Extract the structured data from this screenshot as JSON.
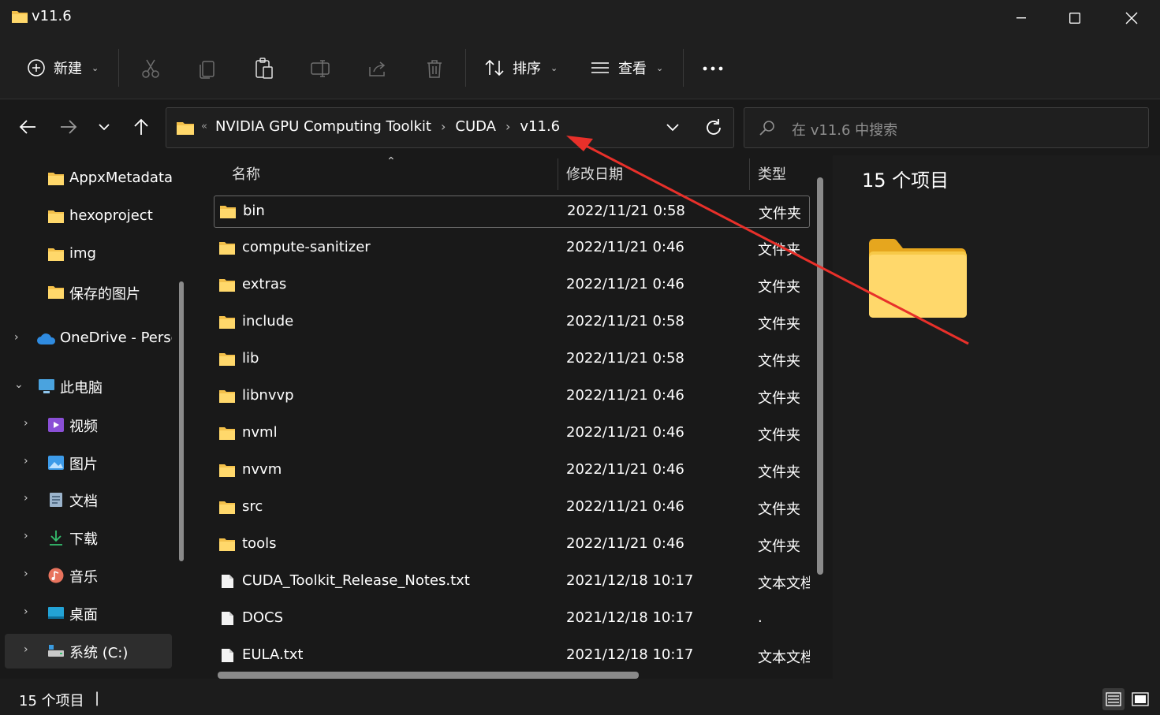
{
  "window": {
    "title": "v11.6"
  },
  "toolbar": {
    "new_label": "新建",
    "sort_label": "排序",
    "view_label": "查看",
    "more_label": "···"
  },
  "address": {
    "lead": "«",
    "crumbs": [
      "NVIDIA GPU Computing Toolkit",
      "CUDA",
      "v11.6"
    ]
  },
  "search": {
    "placeholder": "在 v11.6 中搜索"
  },
  "sidebar": {
    "items": [
      {
        "label": "AppxMetadata",
        "icon": "folder-icon"
      },
      {
        "label": "hexoproject",
        "icon": "folder-icon"
      },
      {
        "label": "img",
        "icon": "folder-icon"
      },
      {
        "label": "保存的图片",
        "icon": "folder-icon"
      },
      {
        "label": "OneDrive - Persc",
        "icon": "onedrive-icon"
      },
      {
        "label": "此电脑",
        "icon": "computer-icon"
      },
      {
        "label": "视频",
        "icon": "video-icon"
      },
      {
        "label": "图片",
        "icon": "pictures-icon"
      },
      {
        "label": "文档",
        "icon": "documents-icon"
      },
      {
        "label": "下载",
        "icon": "download-icon"
      },
      {
        "label": "音乐",
        "icon": "music-icon"
      },
      {
        "label": "桌面",
        "icon": "desktop-icon"
      },
      {
        "label": "系统 (C:)",
        "icon": "drive-icon"
      }
    ]
  },
  "columns": {
    "name": "名称",
    "date": "修改日期",
    "type": "类型"
  },
  "files": [
    {
      "name": "bin",
      "date": "2022/11/21 0:58",
      "type": "文件夹",
      "kind": "folder"
    },
    {
      "name": "compute-sanitizer",
      "date": "2022/11/21 0:46",
      "type": "文件夹",
      "kind": "folder"
    },
    {
      "name": "extras",
      "date": "2022/11/21 0:46",
      "type": "文件夹",
      "kind": "folder"
    },
    {
      "name": "include",
      "date": "2022/11/21 0:58",
      "type": "文件夹",
      "kind": "folder"
    },
    {
      "name": "lib",
      "date": "2022/11/21 0:58",
      "type": "文件夹",
      "kind": "folder"
    },
    {
      "name": "libnvvp",
      "date": "2022/11/21 0:46",
      "type": "文件夹",
      "kind": "folder"
    },
    {
      "name": "nvml",
      "date": "2022/11/21 0:46",
      "type": "文件夹",
      "kind": "folder"
    },
    {
      "name": "nvvm",
      "date": "2022/11/21 0:46",
      "type": "文件夹",
      "kind": "folder"
    },
    {
      "name": "src",
      "date": "2022/11/21 0:46",
      "type": "文件夹",
      "kind": "folder"
    },
    {
      "name": "tools",
      "date": "2022/11/21 0:46",
      "type": "文件夹",
      "kind": "folder"
    },
    {
      "name": "CUDA_Toolkit_Release_Notes.txt",
      "date": "2021/12/18 10:17",
      "type": "文本文档",
      "kind": "file"
    },
    {
      "name": "DOCS",
      "date": "2021/12/18 10:17",
      "type": ".",
      "kind": "file"
    },
    {
      "name": "EULA.txt",
      "date": "2021/12/18 10:17",
      "type": "文本文档",
      "kind": "file"
    }
  ],
  "preview": {
    "count_label": "15 个项目"
  },
  "status": {
    "count_label": "15 个项目"
  },
  "colors": {
    "folder": "#f3c04a",
    "annotation": "#e8302a"
  }
}
